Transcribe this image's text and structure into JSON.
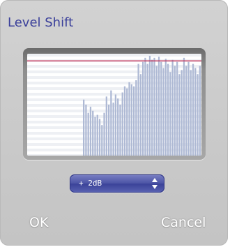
{
  "dialog": {
    "title": "Level Shift"
  },
  "level_select": {
    "value": "+ 2dB"
  },
  "buttons": {
    "ok": "OK",
    "cancel": "Cancel"
  },
  "colors": {
    "title": "#3a3f9a",
    "reference_line": "#c4204a",
    "waveform_bars": "#aeb9d4",
    "select_fill": "#4b53a6"
  },
  "waveform": {
    "start_fraction": 0.32,
    "reference_level": 0.93,
    "levels": [
      0.55,
      0.5,
      0.42,
      0.48,
      0.44,
      0.38,
      0.4,
      0.36,
      0.3,
      0.42,
      0.58,
      0.5,
      0.64,
      0.52,
      0.6,
      0.56,
      0.5,
      0.62,
      0.68,
      0.66,
      0.72,
      0.7,
      0.68,
      0.74,
      0.9,
      0.8,
      0.92,
      0.96,
      0.9,
      0.98,
      0.94,
      0.96,
      0.88,
      0.97,
      0.92,
      0.86,
      0.95,
      0.9,
      0.82,
      0.94,
      0.88,
      0.92,
      0.8,
      0.84,
      0.96,
      0.88,
      0.92,
      0.84,
      0.9,
      0.86,
      0.8,
      0.88
    ]
  }
}
